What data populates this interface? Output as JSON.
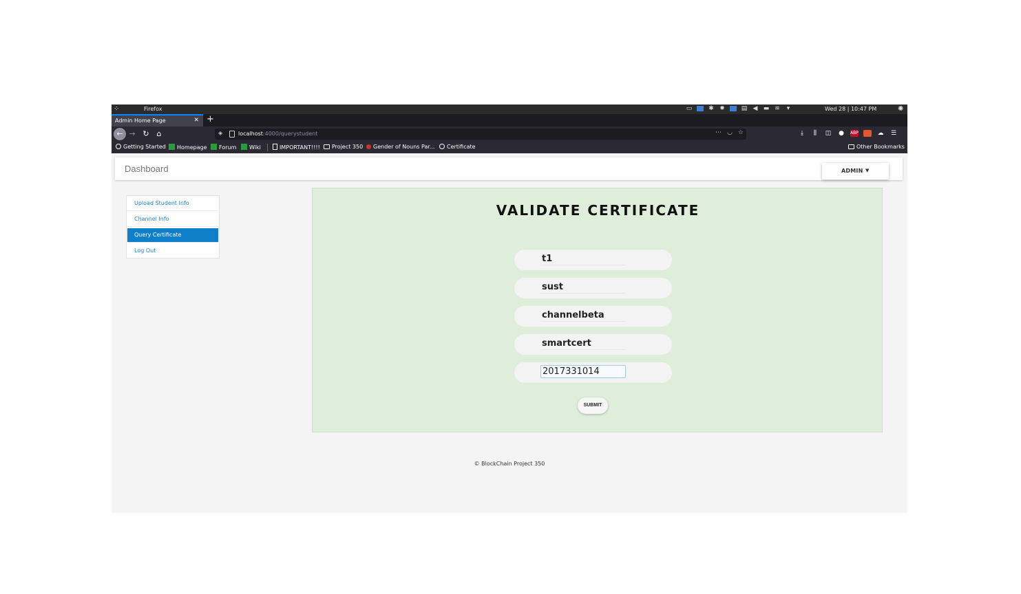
{
  "os": {
    "app_name": "Firefox",
    "clock": "Wed 28 | 10:47 PM"
  },
  "browser": {
    "tab_title": "Admin Home Page",
    "tab_close": "✕",
    "new_tab": "+",
    "url_host": "localhost",
    "url_path": ":4000/querystudent",
    "bookmarks": [
      {
        "label": "Getting Started",
        "icon": "globe-icon"
      },
      {
        "label": "Homepage",
        "icon": "green-bookmark-icon"
      },
      {
        "label": "Forum",
        "icon": "green-bookmark-icon"
      },
      {
        "label": "Wiki",
        "icon": "green-bookmark-icon"
      },
      {
        "label": "IMPORTANT!!!!",
        "icon": "document-icon"
      },
      {
        "label": "Project 350",
        "icon": "folder-icon"
      },
      {
        "label": "Gender of Nouns Par...",
        "icon": "red-dot-icon"
      },
      {
        "label": "Certificate",
        "icon": "globe-icon"
      }
    ],
    "other_bookmarks": "Other Bookmarks"
  },
  "app": {
    "brand": "Dashboard",
    "admin_label": "ADMIN",
    "sidebar": [
      {
        "label": "Upload Student Info",
        "active": false
      },
      {
        "label": "Channel Info",
        "active": false
      },
      {
        "label": "Query Certificate",
        "active": true
      },
      {
        "label": "Log Out",
        "active": false
      }
    ],
    "panel_title": "VALIDATE CERTIFICATE",
    "fields": [
      {
        "value": "t1"
      },
      {
        "value": "sust"
      },
      {
        "value": "channelbeta"
      },
      {
        "value": "smartcert"
      },
      {
        "value": "2017331014"
      }
    ],
    "submit_label": "SUBMIT",
    "footer": "© BlockChain Project 350"
  },
  "colors": {
    "panel_bg": "#dfeedb",
    "active_sidebar": "#0f7fc9",
    "link": "#1a7fc1"
  }
}
